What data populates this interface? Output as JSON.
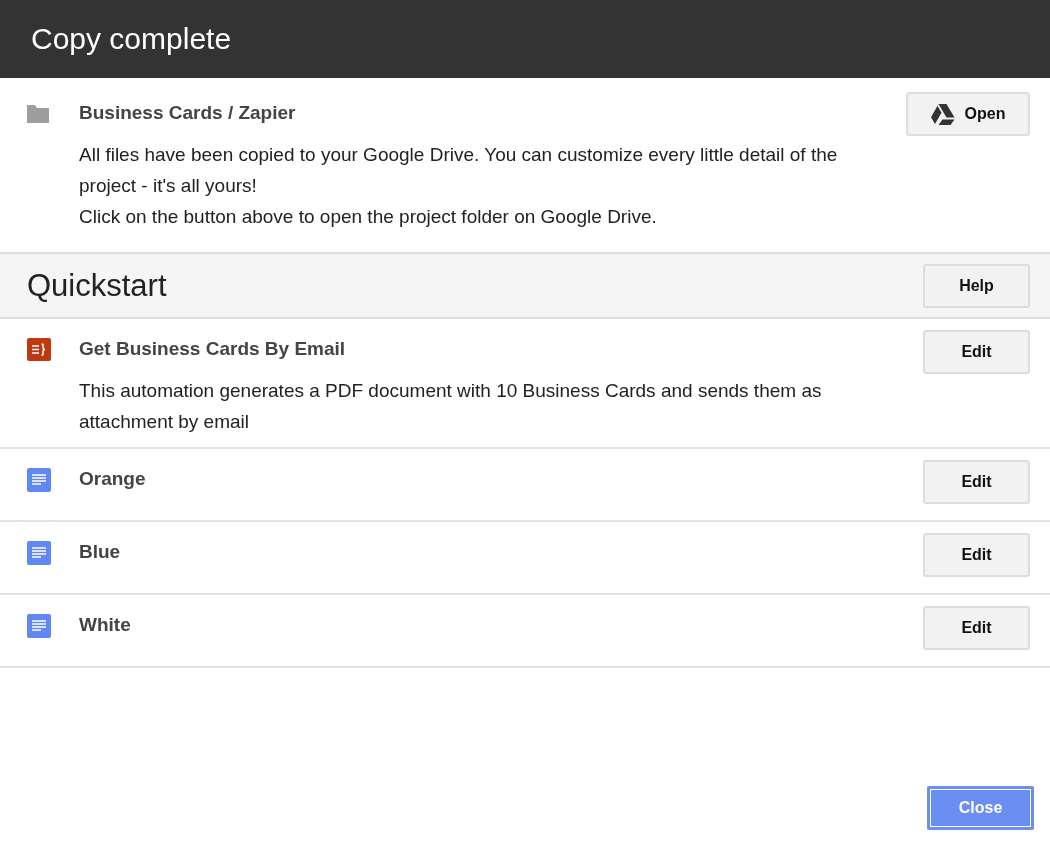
{
  "dialog": {
    "title": "Copy complete"
  },
  "project": {
    "name": "Business Cards / Zapier",
    "button": "Open",
    "description": [
      "All files have been copied to your Google Drive. You can customize every little detail of the project - it's all yours!",
      "Click on the button above to open the project folder on Google Drive."
    ]
  },
  "quickstart": {
    "heading": "Quickstart",
    "button": "Help"
  },
  "items": [
    {
      "kind": "script",
      "name": "Get Business Cards By Email",
      "description": "This automation generates a PDF document with 10 Business Cards and sends them as attachment by email",
      "button": "Edit"
    },
    {
      "kind": "doc",
      "name": "Orange",
      "button": "Edit"
    },
    {
      "kind": "doc",
      "name": "Blue",
      "button": "Edit"
    },
    {
      "kind": "doc",
      "name": "White",
      "button": "Edit"
    }
  ],
  "footer": {
    "button": "Close"
  }
}
